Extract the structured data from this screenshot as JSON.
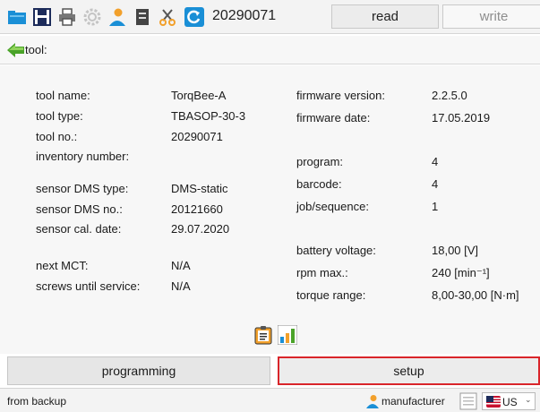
{
  "toolbar": {
    "serial": "20290071",
    "read_label": "read",
    "write_label": "write",
    "icons": [
      "folder-open-icon",
      "save-icon",
      "print-icon",
      "gear-icon",
      "user-icon",
      "document-icon",
      "scissors-icon",
      "refresh-icon"
    ]
  },
  "tool_header": {
    "label": "tool:"
  },
  "info": {
    "left": [
      {
        "label": "tool name:",
        "value": "TorqBee-A"
      },
      {
        "label": "tool type:",
        "value": "TBASOP-30-3"
      },
      {
        "label": "tool no.:",
        "value": "20290071"
      },
      {
        "label": "inventory number:",
        "value": ""
      },
      {
        "label": "sensor DMS type:",
        "value": "DMS-static"
      },
      {
        "label": "sensor DMS no.:",
        "value": "20121660"
      },
      {
        "label": "sensor cal. date:",
        "value": "29.07.2020"
      },
      {
        "label": "next MCT:",
        "value": "N/A"
      },
      {
        "label": "screws until service:",
        "value": "N/A"
      }
    ],
    "right": [
      {
        "label": "firmware version:",
        "value": "2.2.5.0"
      },
      {
        "label": "firmware date:",
        "value": "17.05.2019"
      },
      {
        "label": "program:",
        "value": "4"
      },
      {
        "label": "barcode:",
        "value": "4"
      },
      {
        "label": "job/sequence:",
        "value": "1"
      },
      {
        "label": "battery voltage:",
        "value": "18,00 [V]"
      },
      {
        "label": "rpm max.:",
        "value": "240 [min⁻¹]"
      },
      {
        "label": "torque range:",
        "value": "8,00-30,00 [N·m]"
      }
    ]
  },
  "tabs": {
    "programming": "programming",
    "setup": "setup"
  },
  "statusbar": {
    "source": "from backup",
    "user": "manufacturer",
    "language": "US"
  },
  "colors": {
    "accent_red": "#d9252a",
    "icon_blue": "#1a8fd6",
    "icon_orange": "#f2a02b",
    "icon_green": "#4aa329"
  }
}
